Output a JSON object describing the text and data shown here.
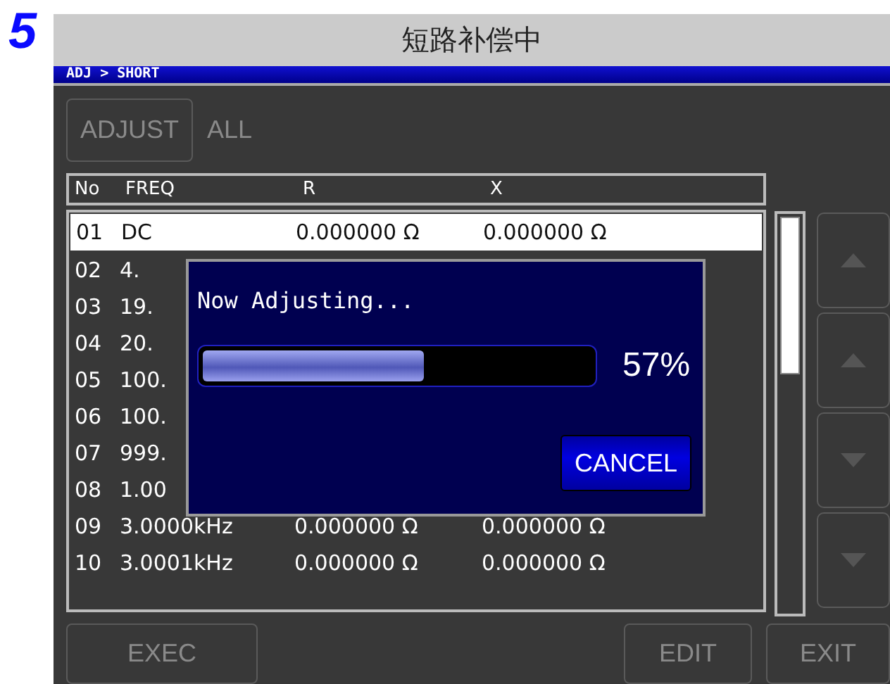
{
  "step": "5",
  "title": "短路补偿中",
  "breadcrumb": "ADJ > SHORT",
  "adjust_button": {
    "label": "ADJUST",
    "disabled": true
  },
  "adjust_value": "ALL",
  "table": {
    "columns": [
      "No",
      "FREQ",
      "R",
      "X"
    ],
    "rows": [
      {
        "no": "01",
        "freq": "DC",
        "r": "0.000000 Ω",
        "x": "0.000000 Ω",
        "selected": true
      },
      {
        "no": "02",
        "freq": "4.",
        "selected": false
      },
      {
        "no": "03",
        "freq": "19.",
        "selected": false
      },
      {
        "no": "04",
        "freq": "20.",
        "selected": false
      },
      {
        "no": "05",
        "freq": "100.",
        "selected": false
      },
      {
        "no": "06",
        "freq": "100.",
        "selected": false
      },
      {
        "no": "07",
        "freq": "999.",
        "selected": false
      },
      {
        "no": "08",
        "freq": "1.00",
        "selected": false
      },
      {
        "no": "09",
        "freq": "3.0000kHz",
        "r": "0.000000 Ω",
        "x": "0.000000 Ω",
        "selected": false
      },
      {
        "no": "10",
        "freq": "3.0001kHz",
        "r": "0.000000 Ω",
        "x": "0.000000 Ω",
        "selected": false
      }
    ]
  },
  "side_buttons": [
    {
      "kind": "up",
      "disabled": true
    },
    {
      "kind": "up",
      "disabled": true
    },
    {
      "kind": "down",
      "disabled": true
    },
    {
      "kind": "down",
      "disabled": true
    }
  ],
  "bottom_buttons": [
    {
      "label": "EXEC",
      "disabled": true
    },
    {
      "label": "EDIT",
      "disabled": true
    },
    {
      "label": "EXIT",
      "disabled": true
    }
  ],
  "dialog": {
    "message": "Now Adjusting...",
    "progress": {
      "level": 0.57,
      "reading": "57%"
    },
    "cancel": "CANCEL"
  }
}
